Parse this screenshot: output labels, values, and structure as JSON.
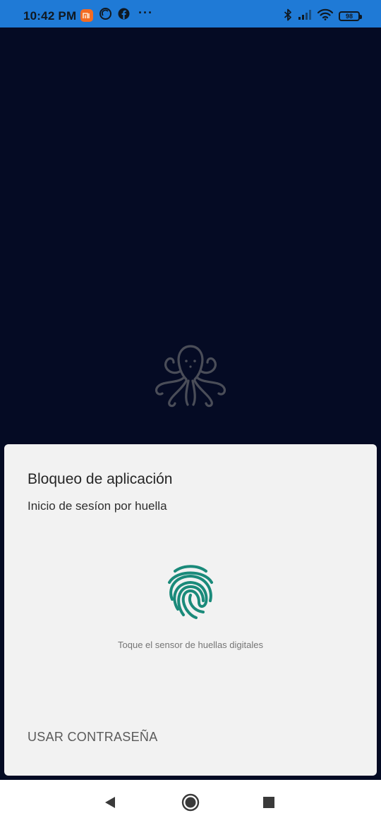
{
  "status_bar": {
    "time": "10:42 PM",
    "battery_level": "98",
    "background_color": "#1f7ad6",
    "left_icons": [
      "mi-app-icon",
      "sync-circle-icon",
      "facebook-icon"
    ],
    "more_indicator": "···",
    "right_icons": [
      "bluetooth-icon",
      "cell-signal-icon",
      "wifi-icon",
      "battery-icon"
    ]
  },
  "app": {
    "background_color": "#050b24",
    "logo_icon": "octopus-logo-icon"
  },
  "dialog": {
    "title": "Bloqueo de aplicación",
    "subtitle": "Inicio de sesíon por huella",
    "fingerprint_icon": "fingerprint-icon",
    "fingerprint_color": "#1a8a7a",
    "hint": "Toque el sensor de huellas digitales",
    "password_button": "USAR CONTRASEÑA"
  },
  "nav_bar": {
    "buttons": [
      "back-triangle-icon",
      "home-circle-icon",
      "recents-square-icon"
    ]
  }
}
